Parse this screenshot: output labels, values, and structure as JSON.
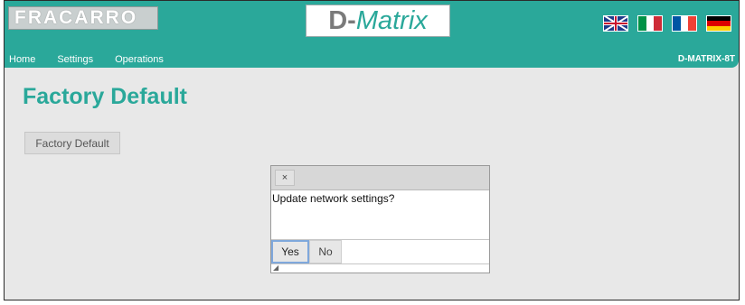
{
  "header": {
    "logo_text": "FRACARRO",
    "brand_d": "D-",
    "brand_matrix": "Matrix",
    "device_name": "D-MATRIX-8T",
    "flags": [
      "flag-uk-icon",
      "flag-italy-icon",
      "flag-france-icon",
      "flag-germany-icon"
    ],
    "accent_color": "#2aa89a"
  },
  "nav": {
    "items": [
      {
        "label": "Home"
      },
      {
        "label": "Settings"
      },
      {
        "label": "Operations"
      }
    ]
  },
  "main": {
    "title": "Factory Default",
    "button_label": "Factory Default"
  },
  "dialog": {
    "close_glyph": "×",
    "message": "Update network settings?",
    "yes_label": "Yes",
    "no_label": "No",
    "resize_glyph": "◢"
  }
}
